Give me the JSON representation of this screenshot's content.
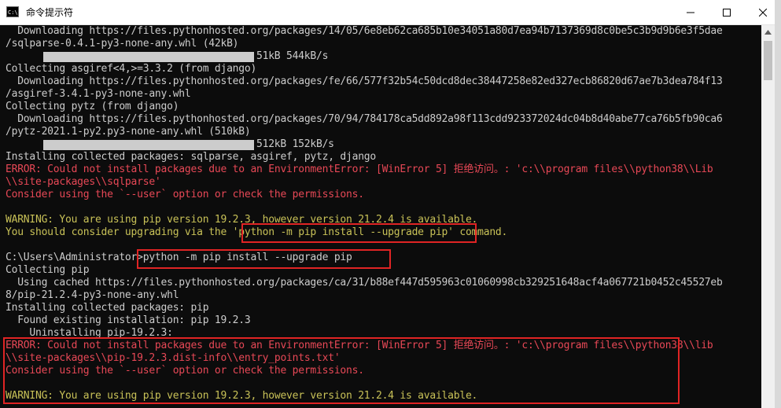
{
  "window": {
    "title": "命令提示符",
    "icon": "terminal-icon"
  },
  "console": {
    "lines": [
      {
        "type": "normal",
        "text": "  Downloading https://files.pythonhosted.org/packages/14/05/6e8eb62ca685b10e34051a80d7ea94b7137369d8c0be5c3b9d9b6e3f5dae"
      },
      {
        "type": "normal",
        "text": "/sqlparse-0.4.1-py3-none-any.whl (42kB)"
      },
      {
        "type": "progress",
        "text": "51kB 544kB/s",
        "progress": 1.0
      },
      {
        "type": "normal",
        "text": "Collecting asgiref<4,>=3.3.2 (from django)"
      },
      {
        "type": "normal",
        "text": "  Downloading https://files.pythonhosted.org/packages/fe/66/577f32b54c50dcd8dec38447258e82ed327ecb86820d67ae7b3dea784f13"
      },
      {
        "type": "normal",
        "text": "/asgiref-3.4.1-py3-none-any.whl"
      },
      {
        "type": "normal",
        "text": "Collecting pytz (from django)"
      },
      {
        "type": "normal",
        "text": "  Downloading https://files.pythonhosted.org/packages/70/94/784178ca5dd892a98f113cdd923372024dc04b8d40abe77ca76b5fb90ca6"
      },
      {
        "type": "normal",
        "text": "/pytz-2021.1-py2.py3-none-any.whl (510kB)"
      },
      {
        "type": "progress",
        "text": "512kB 152kB/s",
        "progress": 1.0
      },
      {
        "type": "normal",
        "text": "Installing collected packages: sqlparse, asgiref, pytz, django"
      },
      {
        "type": "error",
        "text": "ERROR: Could not install packages due to an EnvironmentError: [WinError 5] 拒绝访问。: 'c:\\\\program files\\\\python38\\\\Lib"
      },
      {
        "type": "error",
        "text": "\\\\site-packages\\\\sqlparse'"
      },
      {
        "type": "error",
        "text": "Consider using the `--user` option or check the permissions."
      },
      {
        "type": "blank",
        "text": ""
      },
      {
        "type": "warn",
        "text": "WARNING: You are using pip version 19.2.3, however version 21.2.4 is available."
      },
      {
        "type": "warn",
        "text": "You should consider upgrading via the 'python -m pip install --upgrade pip' command."
      },
      {
        "type": "blank",
        "text": ""
      },
      {
        "type": "normal",
        "text": "C:\\Users\\Administrator>python -m pip install --upgrade pip"
      },
      {
        "type": "normal",
        "text": "Collecting pip"
      },
      {
        "type": "normal",
        "text": "  Using cached https://files.pythonhosted.org/packages/ca/31/b88ef447d595963c01060998cb329251648acf4a067721b0452c45527eb"
      },
      {
        "type": "normal",
        "text": "8/pip-21.2.4-py3-none-any.whl"
      },
      {
        "type": "normal",
        "text": "Installing collected packages: pip"
      },
      {
        "type": "normal",
        "text": "  Found existing installation: pip 19.2.3"
      },
      {
        "type": "normal",
        "text": "    Uninstalling pip-19.2.3:"
      },
      {
        "type": "error",
        "text": "ERROR: Could not install packages due to an EnvironmentError: [WinError 5] 拒绝访问。: 'c:\\\\program files\\\\python38\\\\lib"
      },
      {
        "type": "error",
        "text": "\\\\site-packages\\\\pip-19.2.3.dist-info\\\\entry_points.txt'"
      },
      {
        "type": "error",
        "text": "Consider using the `--user` option or check the permissions."
      },
      {
        "type": "blank",
        "text": ""
      },
      {
        "type": "warn",
        "text": "WARNING: You are using pip version 19.2.3, however version 21.2.4 is available."
      }
    ]
  },
  "colors": {
    "error": "#e74856",
    "warning": "#c8c157",
    "normal": "#cccccc",
    "highlight": "#e02424"
  }
}
